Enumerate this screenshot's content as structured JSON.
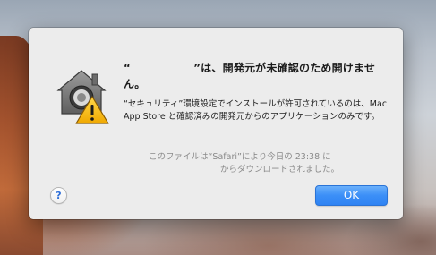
{
  "dialog": {
    "title_prefix": "“",
    "title_suffix": "”は、開発元が未確認のため開けません。",
    "message": "“セキュリティ”環境設定でインストールが許可されているのは、Mac App Store と確認済みの開発元からのアプリケーションのみです。",
    "download_info_line1": "このファイルは“Safari”により今日の 23:38 に",
    "download_info_line2": "からダウンロードされました。",
    "help_label": "?",
    "ok_label": "OK"
  },
  "icon": "gatekeeper-warning-icon",
  "colors": {
    "ok_button": "#3b8ff7",
    "dialog_background": "#ececec",
    "help_glyph": "#2f6fd8"
  }
}
